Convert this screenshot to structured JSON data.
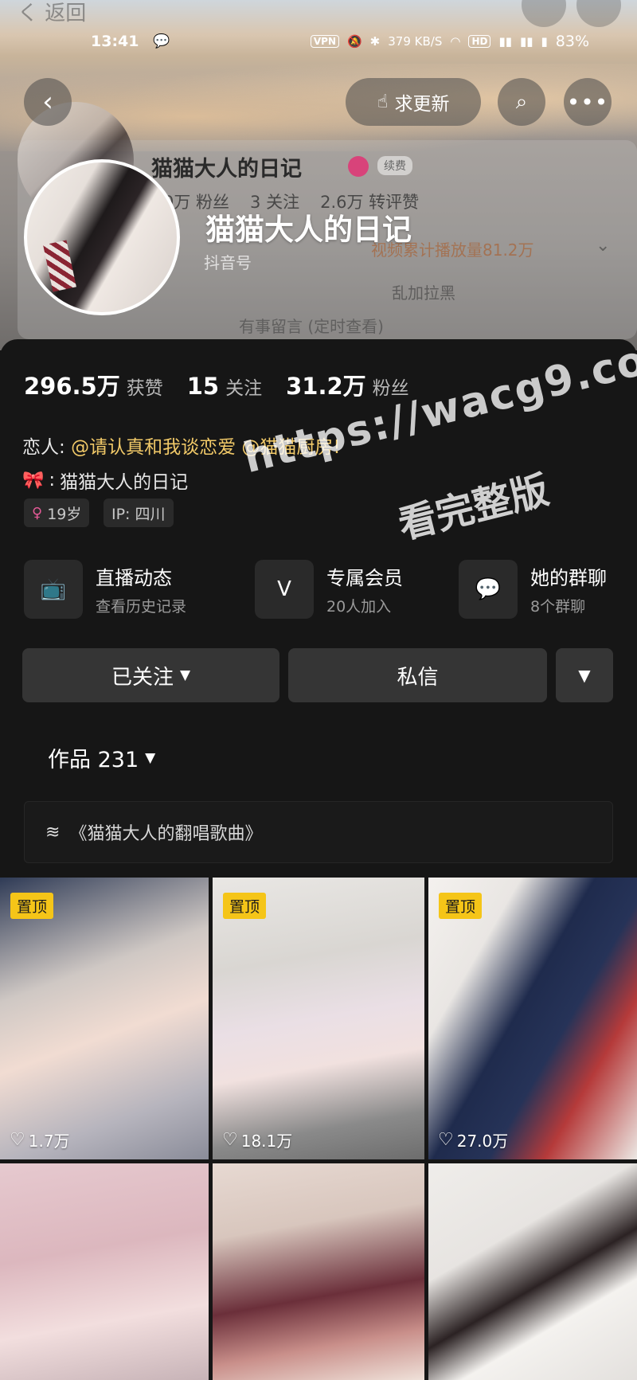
{
  "header": {
    "ghost_back": "く 返回",
    "status": {
      "time": "13:41",
      "network_speed": "379 KB/S",
      "battery": "83%"
    },
    "request_update_label": "求更新",
    "ghost_card": {
      "name": "猫猫大人的日记",
      "renew_label": "续费",
      "stats": [
        "0万 粉丝",
        "3 关注",
        "2.6万 转评赞"
      ],
      "line2": "视频累计播放量81.2万",
      "line3": "乱加拉黑",
      "line4": "有事留言 (定时查看)"
    },
    "overlay_name": "猫猫大人的日记",
    "douyin_id_label": "抖音号"
  },
  "profile": {
    "stats": [
      {
        "num": "296.5万",
        "label": "获赞"
      },
      {
        "num": "15",
        "label": "关注"
      },
      {
        "num": "31.2万",
        "label": "粉丝"
      }
    ],
    "lover_prefix": "恋人: ",
    "lover_link1": "@请认真和我谈恋爱",
    "lover_link2": "@猫猫厨房!",
    "bio_text": "猫猫大人的日记",
    "bio_prefix": ":",
    "tags": {
      "age": "19岁",
      "ip": "IP: 四川"
    }
  },
  "features": [
    {
      "title": "直播动态",
      "sub": "查看历史记录"
    },
    {
      "title": "专属会员",
      "sub": "20人加入"
    },
    {
      "title": "她的群聊",
      "sub": "8个群聊"
    }
  ],
  "actions": {
    "followed_label": "已关注",
    "message_label": "私信"
  },
  "works": {
    "tab_label": "作品 231",
    "collection_label": "《猫猫大人的翻唱歌曲》"
  },
  "grid": [
    {
      "pinned": "置顶",
      "likes": "1.7万"
    },
    {
      "pinned": "置顶",
      "likes": "18.1万"
    },
    {
      "pinned": "置顶",
      "likes": "27.0万"
    }
  ],
  "watermark": {
    "line1": "https://wacg9.com",
    "line2": "看完整版"
  },
  "colors": {
    "accent_link": "#f1c968",
    "pin_badge": "#f5c518",
    "panel_bg": "#161616"
  }
}
